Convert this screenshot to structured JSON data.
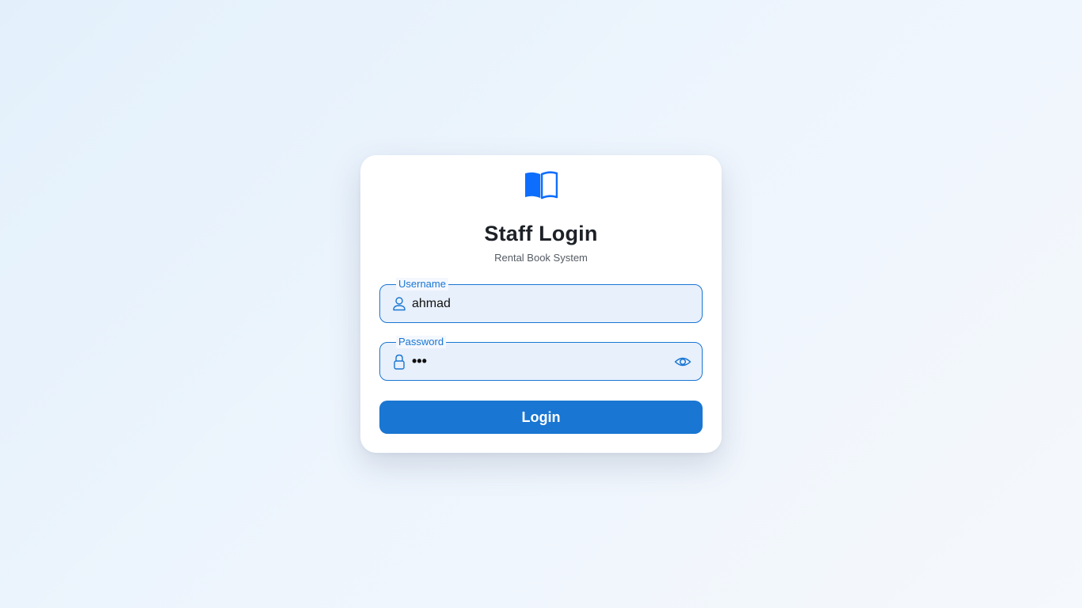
{
  "colors": {
    "accent": "#1976d2",
    "logo": "#0d6efd",
    "field_bg": "#e8f0fc",
    "title": "#1d2127"
  },
  "header": {
    "logo_icon": "open-book-icon",
    "title": "Staff Login",
    "subtitle": "Rental Book System"
  },
  "form": {
    "username": {
      "label": "Username",
      "value": "ahmad",
      "icon": "person-icon"
    },
    "password": {
      "label": "Password",
      "value": "•••",
      "icon": "lock-icon",
      "toggle_icon": "eye-icon"
    },
    "login_label": "Login"
  }
}
